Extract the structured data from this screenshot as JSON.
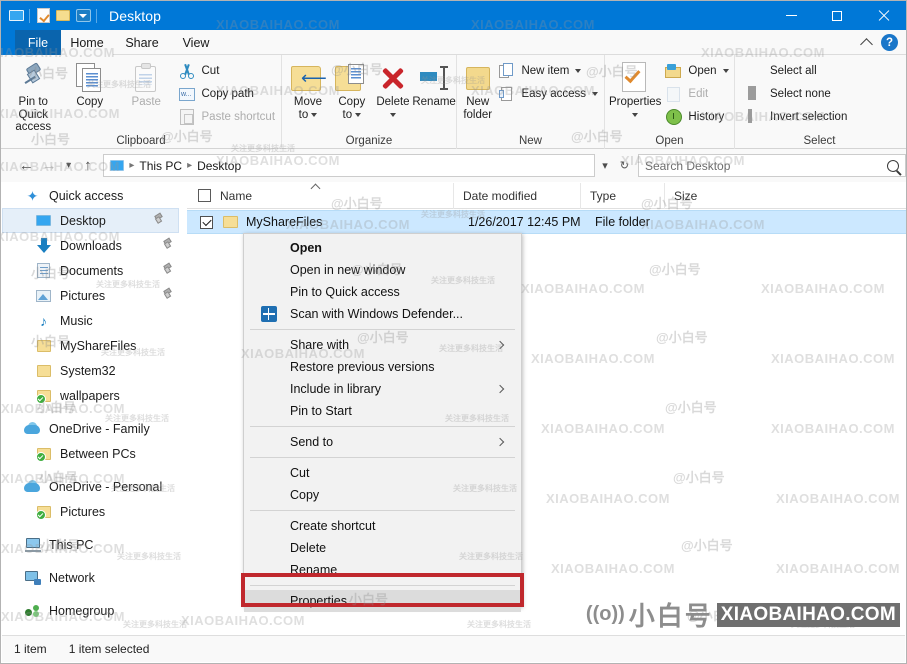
{
  "window": {
    "title": "Desktop",
    "quick_access_icons": [
      "monitor-icon",
      "properties-icon",
      "new-folder-icon",
      "customize-dropdown-icon"
    ],
    "controls": {
      "minimize": "minimize-icon",
      "maximize": "maximize-icon",
      "close": "close-icon"
    }
  },
  "tabs": [
    {
      "label": "File",
      "active": false,
      "id": "file"
    },
    {
      "label": "Home",
      "active": true,
      "id": "home"
    },
    {
      "label": "Share",
      "active": false,
      "id": "share"
    },
    {
      "label": "View",
      "active": false,
      "id": "view"
    }
  ],
  "ribbon": {
    "collapse_icon": "chevron-up-icon",
    "help_label": "?",
    "groups": [
      {
        "name": "Clipboard",
        "big_buttons": [
          {
            "label_line1": "Pin to Quick",
            "label_line2": "access",
            "icon": "pin-icon"
          },
          {
            "label_line1": "Copy",
            "label_line2": "",
            "icon": "copy-icon"
          },
          {
            "label_line1": "Paste",
            "label_line2": "",
            "icon": "paste-icon",
            "disabled": true
          }
        ],
        "small_buttons": [
          {
            "label": "Cut",
            "icon": "scissors-icon",
            "disabled": false
          },
          {
            "label": "Copy path",
            "icon": "copy-path-icon",
            "disabled": false
          },
          {
            "label": "Paste shortcut",
            "icon": "paste-shortcut-icon",
            "disabled": true
          }
        ]
      },
      {
        "name": "Organize",
        "big_buttons": [
          {
            "label_line1": "Move",
            "label_line2": "to",
            "icon": "move-to-icon",
            "dropdown": true
          },
          {
            "label_line1": "Copy",
            "label_line2": "to",
            "icon": "copy-to-icon",
            "dropdown": true
          },
          {
            "label_line1": "Delete",
            "label_line2": "",
            "icon": "delete-icon",
            "dropdown": true
          },
          {
            "label_line1": "Rename",
            "label_line2": "",
            "icon": "rename-icon"
          }
        ],
        "small_buttons": []
      },
      {
        "name": "New",
        "big_buttons": [
          {
            "label_line1": "New",
            "label_line2": "folder",
            "icon": "new-folder-icon"
          }
        ],
        "small_buttons": [
          {
            "label": "New item",
            "icon": "new-item-icon",
            "dropdown": true
          },
          {
            "label": "Easy access",
            "icon": "easy-access-icon",
            "dropdown": true
          }
        ]
      },
      {
        "name": "Open",
        "big_buttons": [
          {
            "label_line1": "Properties",
            "label_line2": "",
            "icon": "properties-icon",
            "dropdown": true
          }
        ],
        "small_buttons": [
          {
            "label": "Open",
            "icon": "open-icon",
            "dropdown": true
          },
          {
            "label": "Edit",
            "icon": "edit-icon",
            "disabled": true
          },
          {
            "label": "History",
            "icon": "history-icon"
          }
        ]
      },
      {
        "name": "Select",
        "big_buttons": [],
        "small_buttons": [
          {
            "label": "Select all",
            "icon": "select-all-icon"
          },
          {
            "label": "Select none",
            "icon": "select-none-icon"
          },
          {
            "label": "Invert selection",
            "icon": "invert-selection-icon"
          }
        ]
      }
    ]
  },
  "address": {
    "back_icon": "back-arrow-icon",
    "forward_icon": "forward-arrow-icon",
    "recent_icon": "chevron-down-icon",
    "up_icon": "up-arrow-icon",
    "breadcrumb": [
      "This PC",
      "Desktop"
    ],
    "dropdown_icon": "chevron-down-icon",
    "refresh_icon": "refresh-icon"
  },
  "search": {
    "placeholder": "Search Desktop",
    "value": "",
    "icon": "search-icon"
  },
  "columns": [
    {
      "label": "Name",
      "sorted": true,
      "sort_dir": "asc"
    },
    {
      "label": "Date modified",
      "sorted": false
    },
    {
      "label": "Type",
      "sorted": false
    },
    {
      "label": "Size",
      "sorted": false
    }
  ],
  "sidebar": {
    "items": [
      {
        "label": "Quick access",
        "icon": "star-icon",
        "indent": 0,
        "selected": false,
        "pinned": false
      },
      {
        "label": "Desktop",
        "icon": "desktop-icon",
        "indent": 1,
        "selected": true,
        "pinned": true
      },
      {
        "label": "Downloads",
        "icon": "downloads-icon",
        "indent": 1,
        "selected": false,
        "pinned": true
      },
      {
        "label": "Documents",
        "icon": "documents-icon",
        "indent": 1,
        "selected": false,
        "pinned": true
      },
      {
        "label": "Pictures",
        "icon": "pictures-icon",
        "indent": 1,
        "selected": false,
        "pinned": true
      },
      {
        "label": "Music",
        "icon": "music-icon",
        "indent": 1,
        "selected": false,
        "pinned": false
      },
      {
        "label": "MyShareFiles",
        "icon": "folder-icon",
        "indent": 1,
        "selected": false,
        "pinned": false
      },
      {
        "label": "System32",
        "icon": "folder-icon",
        "indent": 1,
        "selected": false,
        "pinned": false
      },
      {
        "label": "wallpapers",
        "icon": "folder-sync-icon",
        "indent": 1,
        "selected": false,
        "pinned": false
      },
      {
        "label": "OneDrive - Family",
        "icon": "cloud-icon",
        "indent": 0,
        "selected": false,
        "pinned": false
      },
      {
        "label": "Between PCs",
        "icon": "folder-sync-icon",
        "indent": 1,
        "selected": false,
        "pinned": false
      },
      {
        "label": "OneDrive - Personal",
        "icon": "cloud-icon",
        "indent": 0,
        "selected": false,
        "pinned": false
      },
      {
        "label": "Pictures",
        "icon": "folder-sync-icon",
        "indent": 1,
        "selected": false,
        "pinned": false
      },
      {
        "label": "This PC",
        "icon": "this-pc-icon",
        "indent": 0,
        "selected": false,
        "pinned": false
      },
      {
        "label": "Network",
        "icon": "network-icon",
        "indent": 0,
        "selected": false,
        "pinned": false
      },
      {
        "label": "Homegroup",
        "icon": "homegroup-icon",
        "indent": 0,
        "selected": false,
        "pinned": false
      }
    ]
  },
  "files": [
    {
      "name": "MyShareFiles",
      "date_modified": "1/26/2017 12:45 PM",
      "type": "File folder",
      "size": "",
      "selected": true,
      "checked": true,
      "icon": "folder-icon"
    }
  ],
  "context_menu": {
    "items": [
      {
        "label": "Open",
        "bold": true,
        "icon": null,
        "submenu": false,
        "highlight": false
      },
      {
        "label": "Open in new window",
        "bold": false,
        "icon": null,
        "submenu": false,
        "highlight": false
      },
      {
        "label": "Pin to Quick access",
        "bold": false,
        "icon": null,
        "submenu": false,
        "highlight": false
      },
      {
        "label": "Scan with Windows Defender...",
        "bold": false,
        "icon": "defender-shield-icon",
        "submenu": false,
        "highlight": false
      },
      {
        "separator": true
      },
      {
        "label": "Share with",
        "bold": false,
        "icon": null,
        "submenu": true,
        "highlight": false
      },
      {
        "label": "Restore previous versions",
        "bold": false,
        "icon": null,
        "submenu": false,
        "highlight": false
      },
      {
        "label": "Include in library",
        "bold": false,
        "icon": null,
        "submenu": true,
        "highlight": false
      },
      {
        "label": "Pin to Start",
        "bold": false,
        "icon": null,
        "submenu": false,
        "highlight": false
      },
      {
        "separator": true
      },
      {
        "label": "Send to",
        "bold": false,
        "icon": null,
        "submenu": true,
        "highlight": false
      },
      {
        "separator": true
      },
      {
        "label": "Cut",
        "bold": false,
        "icon": null,
        "submenu": false,
        "highlight": false
      },
      {
        "label": "Copy",
        "bold": false,
        "icon": null,
        "submenu": false,
        "highlight": false
      },
      {
        "separator": true
      },
      {
        "label": "Create shortcut",
        "bold": false,
        "icon": null,
        "submenu": false,
        "highlight": false
      },
      {
        "label": "Delete",
        "bold": false,
        "icon": null,
        "submenu": false,
        "highlight": false
      },
      {
        "label": "Rename",
        "bold": false,
        "icon": null,
        "submenu": false,
        "highlight": false
      },
      {
        "separator": true
      },
      {
        "label": "Properties",
        "bold": false,
        "icon": null,
        "submenu": false,
        "highlight": true
      }
    ],
    "highlight_color": "#c0282d"
  },
  "status_bar": {
    "item_count": "1 item",
    "selection": "1 item selected"
  },
  "watermark": {
    "brand_wave": "((o))",
    "brand_cn": "小白号",
    "brand_domain": "XIAOBAIHAO.COM",
    "tile_text": "XIAOBAIHAO.COM",
    "tile_cn": "@小白号",
    "tile_sub": "关注更多科技生活"
  },
  "colors": {
    "titlebar": "#0078d7",
    "accent": "#0078d7",
    "selection": "#cce8ff",
    "highlight_red": "#c0282d",
    "ribbon_bg": "#f9f9f9"
  }
}
